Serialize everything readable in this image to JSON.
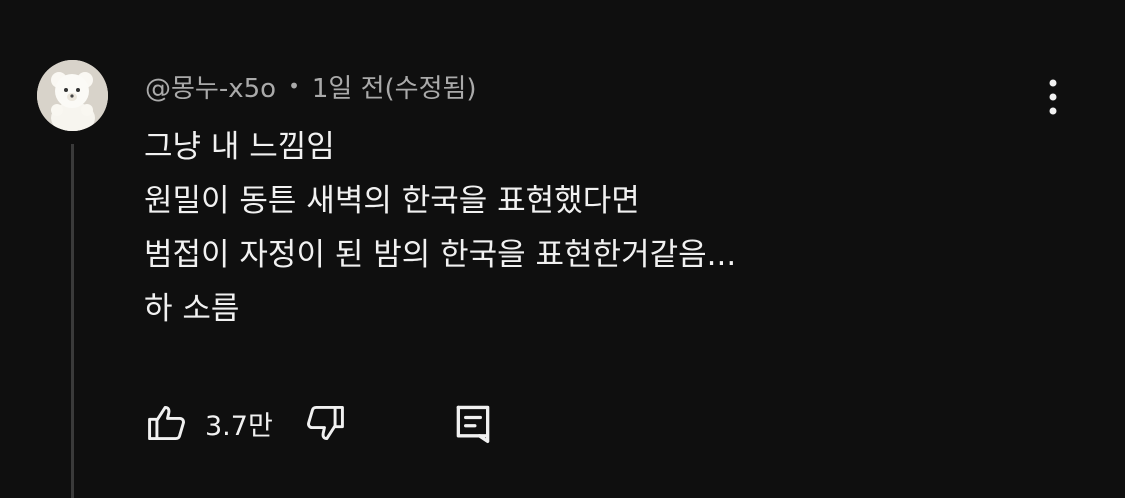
{
  "comment": {
    "author": "@몽누-x5o",
    "separator": "•",
    "timestamp": "1일 전(수정됨)",
    "lines": [
      "그냥 내 느낌임",
      "원밀이 동튼 새벽의 한국을 표현했다면",
      "범접이 자정이 된 밤의 한국을 표현한거같음...",
      "하 소름"
    ],
    "likes": "3.7만",
    "avatar": "avatar-image",
    "icons": {
      "more": "more-vertical-icon",
      "like": "thumbs-up-icon",
      "dislike": "thumbs-down-icon",
      "reply": "reply-icon"
    }
  },
  "colors": {
    "background": "#0f0f0f",
    "text": "#f1f1f1",
    "secondary_text": "#aaaaaa",
    "thread_line": "#3a3a3a"
  }
}
